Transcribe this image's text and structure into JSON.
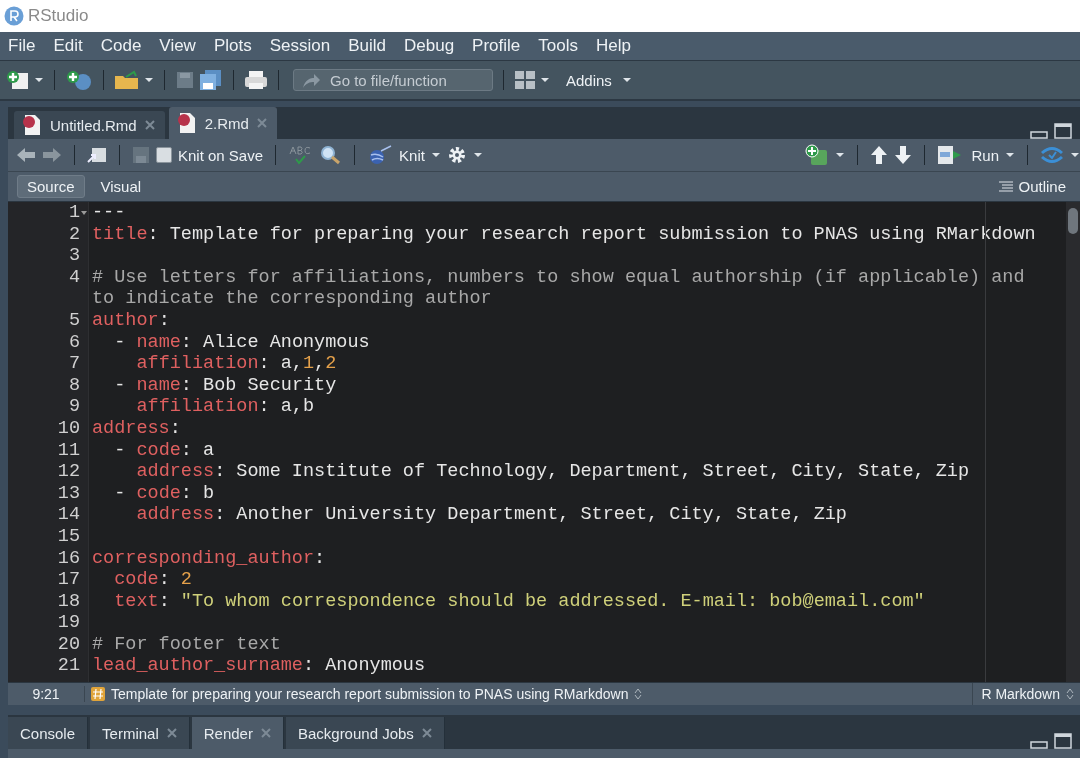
{
  "window": {
    "title": "RStudio"
  },
  "menu": [
    "File",
    "Edit",
    "Code",
    "View",
    "Plots",
    "Session",
    "Build",
    "Debug",
    "Profile",
    "Tools",
    "Help"
  ],
  "main_toolbar": {
    "go_to_placeholder": "Go to file/function",
    "addins": "Addins"
  },
  "editor_tabs": [
    {
      "label": "Untitled.Rmd",
      "selected": false
    },
    {
      "label": "2.Rmd",
      "selected": true
    }
  ],
  "editor_toolbar": {
    "knit_on_save": {
      "label": "Knit on Save",
      "checked": false
    },
    "knit": "Knit",
    "run": "Run"
  },
  "mode_tabs": [
    {
      "label": "Source",
      "selected": true
    },
    {
      "label": "Visual",
      "selected": false
    }
  ],
  "outline": "Outline",
  "code_lines": [
    {
      "number": "1",
      "foldable": true,
      "tokens": [
        {
          "kind": "text",
          "text": "---"
        }
      ]
    },
    {
      "number": "2",
      "foldable": false,
      "tokens": [
        {
          "kind": "key",
          "text": "title"
        },
        {
          "kind": "text",
          "text": ": Template for preparing your research report submission to PNAS using RMarkdown"
        }
      ]
    },
    {
      "number": "3",
      "foldable": false
    },
    {
      "number": "4",
      "foldable": false,
      "tokens": [
        {
          "kind": "comment",
          "text": "# Use letters for affiliations, numbers to show equal authorship (if applicable) and to indicate the corresponding author"
        }
      ]
    },
    {
      "number": "5",
      "foldable": false,
      "tokens": [
        {
          "kind": "key",
          "text": "author"
        },
        {
          "kind": "text",
          "text": ":"
        }
      ]
    },
    {
      "number": "6",
      "foldable": false,
      "tokens": [
        {
          "kind": "text",
          "text": "  - "
        },
        {
          "kind": "key",
          "text": "name"
        },
        {
          "kind": "text",
          "text": ": Alice Anonymous"
        }
      ]
    },
    {
      "number": "7",
      "foldable": false,
      "tokens": [
        {
          "kind": "key",
          "text": "    affiliation"
        },
        {
          "kind": "text",
          "text": ": a,"
        },
        {
          "kind": "number",
          "text": "1"
        },
        {
          "kind": "text",
          "text": ","
        },
        {
          "kind": "number",
          "text": "2"
        }
      ]
    },
    {
      "number": "8",
      "foldable": false,
      "tokens": [
        {
          "kind": "text",
          "text": "  - "
        },
        {
          "kind": "key",
          "text": "name"
        },
        {
          "kind": "text",
          "text": ": Bob Security"
        }
      ]
    },
    {
      "number": "9",
      "foldable": false,
      "tokens": [
        {
          "kind": "key",
          "text": "    affiliation"
        },
        {
          "kind": "text",
          "text": ": a,b"
        }
      ]
    },
    {
      "number": "10",
      "foldable": false,
      "tokens": [
        {
          "kind": "key",
          "text": "address"
        },
        {
          "kind": "text",
          "text": ":"
        }
      ]
    },
    {
      "number": "11",
      "foldable": false,
      "tokens": [
        {
          "kind": "text",
          "text": "  - "
        },
        {
          "kind": "key",
          "text": "code"
        },
        {
          "kind": "text",
          "text": ": a"
        }
      ]
    },
    {
      "number": "12",
      "foldable": false,
      "tokens": [
        {
          "kind": "key",
          "text": "    address"
        },
        {
          "kind": "text",
          "text": ": Some Institute of Technology, Department, Street, City, State, Zip"
        }
      ]
    },
    {
      "number": "13",
      "foldable": false,
      "tokens": [
        {
          "kind": "text",
          "text": "  - "
        },
        {
          "kind": "key",
          "text": "code"
        },
        {
          "kind": "text",
          "text": ": b"
        }
      ]
    },
    {
      "number": "14",
      "foldable": false,
      "tokens": [
        {
          "kind": "key",
          "text": "    address"
        },
        {
          "kind": "text",
          "text": ": Another University Department, Street, City, State, Zip"
        }
      ]
    },
    {
      "number": "15",
      "foldable": false
    },
    {
      "number": "16",
      "foldable": false,
      "tokens": [
        {
          "kind": "key",
          "text": "corresponding_author"
        },
        {
          "kind": "text",
          "text": ":"
        }
      ]
    },
    {
      "number": "17",
      "foldable": false,
      "tokens": [
        {
          "kind": "key",
          "text": "  code"
        },
        {
          "kind": "text",
          "text": ": "
        },
        {
          "kind": "number",
          "text": "2"
        }
      ]
    },
    {
      "number": "18",
      "foldable": false,
      "tokens": [
        {
          "kind": "key",
          "text": "  text"
        },
        {
          "kind": "text",
          "text": ": "
        },
        {
          "kind": "string",
          "text": "\"To whom correspondence should be addressed. E-mail: bob@email.com\""
        }
      ]
    },
    {
      "number": "19",
      "foldable": false
    },
    {
      "number": "20",
      "foldable": false,
      "tokens": [
        {
          "kind": "comment",
          "text": "# For footer text"
        }
      ]
    },
    {
      "number": "21",
      "foldable": false,
      "tokens": [
        {
          "kind": "key",
          "text": "lead_author_surname"
        },
        {
          "kind": "text",
          "text": ": Anonymous"
        }
      ]
    }
  ],
  "status_bar": {
    "position": "9:21",
    "section": "Template for preparing your research report submission to PNAS using RMarkdown",
    "file_type": "R Markdown"
  },
  "bottom_tabs": [
    {
      "label": "Console",
      "closable": false,
      "selected": false
    },
    {
      "label": "Terminal",
      "closable": true,
      "selected": false
    },
    {
      "label": "Render",
      "closable": true,
      "selected": true
    },
    {
      "label": "Background Jobs",
      "closable": true,
      "selected": false
    }
  ]
}
